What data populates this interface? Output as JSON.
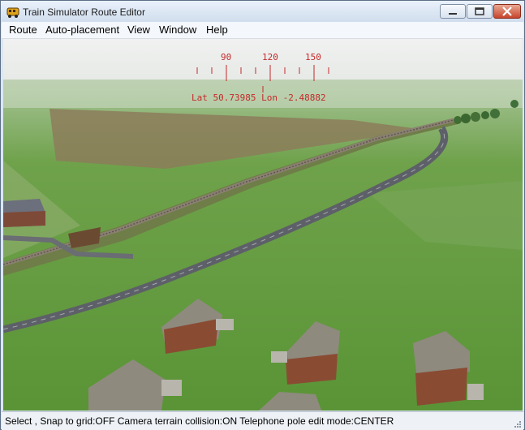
{
  "window": {
    "title": "Train Simulator Route Editor"
  },
  "menu": {
    "items": [
      "Route",
      "Auto-placement",
      "View",
      "Window",
      "Help"
    ]
  },
  "hud": {
    "compass_ticks": [
      "90",
      "120",
      "150"
    ],
    "position": "Lat 50.73985 Lon -2.48882"
  },
  "status": {
    "text": "Select , Snap to grid:OFF Camera terrain collision:ON Telephone pole edit mode:CENTER"
  },
  "colors": {
    "hud_red": "#c42a2a",
    "grass": "#5f9a3c",
    "sky": "#e9ebe9"
  }
}
